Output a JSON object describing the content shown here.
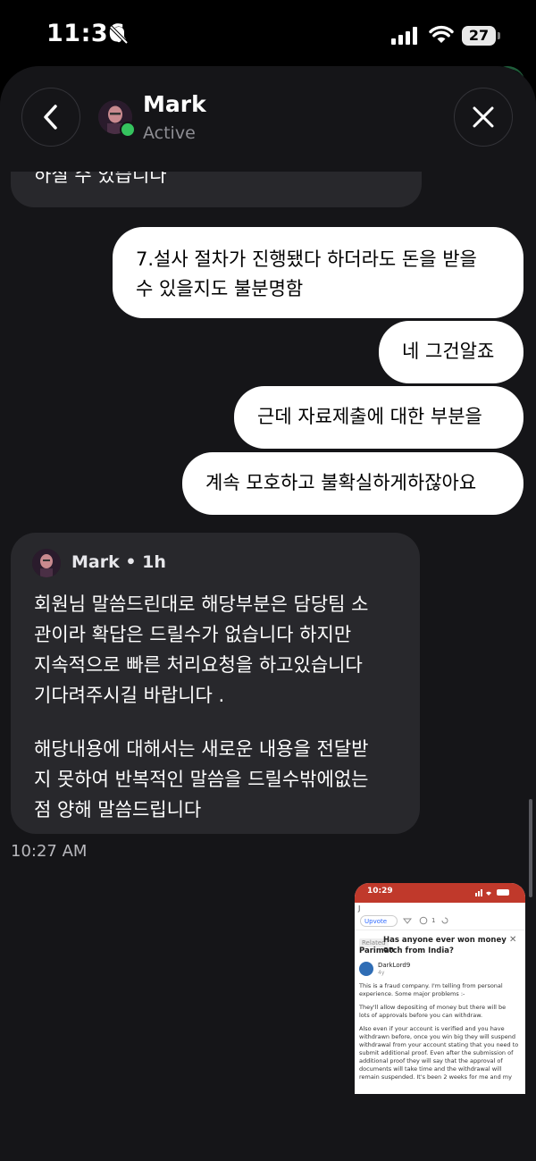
{
  "status_bar": {
    "time": "11:36",
    "battery": "27"
  },
  "header": {
    "name": "Mark",
    "status": "Active"
  },
  "messages": {
    "incoming_top": "하실 수 있습니다",
    "outgoing": [
      {
        "lines": [
          "7.설사 절차가 진행됐다 하더라도 돈을 받을",
          "수 있을지도 불분명함"
        ]
      },
      {
        "lines": [
          "네 그건알죠"
        ]
      },
      {
        "lines": [
          "근데 자료제출에 대한 부분을"
        ]
      },
      {
        "lines": [
          "계속 모호하고 불확실하게하잖아요"
        ]
      }
    ],
    "card": {
      "author": "Mark • 1h",
      "lines": [
        "회원님 말씀드린대로 해당부분은 담당팀 소",
        "관이라 확답은 드릴수가 없습니다 하지만",
        "지속적으로 빠른 처리요청을 하고있습니다",
        "기다려주시길 바랍니다 .",
        "",
        "해당내용에 대해서는 새로운 내용을 전달받",
        "지 못하여 반복적인 말씀을 드릴수밖에없는",
        "점 양해 말씀드립니다"
      ]
    },
    "timestamp": "10:27 AM"
  },
  "thumbnail": {
    "status_time": "10:29",
    "mini_label": "J",
    "upvote": "Upvote",
    "comment_count": "1",
    "related_tag": "Related",
    "question_line1": "Has anyone ever won money on",
    "question_line2": "Parimatch from India?",
    "username": "DarkLord9",
    "user_age": "4y",
    "paragraphs": [
      "This is a fraud company. I'm telling from personal",
      "experience. Some major problems :-",
      "They'll allow depositing of money but there will be",
      "lots of approvals before you can withdraw.",
      "Also even if your account is verified and you have",
      "withdrawn before, once you win big they will suspend",
      "withdrawal from your account stating that you need to",
      "submit additional proof. Even after the submission of",
      "additional proof they will say that the approval of",
      "documents will take time and the withdrawal will",
      "remain suspended. It's been 2 weeks for me and my"
    ],
    "accent_color": "#c0392b"
  },
  "icons": {
    "back": "chevron-left-icon",
    "close": "close-icon",
    "bell_off": "bell-slash-icon",
    "signal": "cellular-signal-icon",
    "wifi": "wifi-icon"
  }
}
